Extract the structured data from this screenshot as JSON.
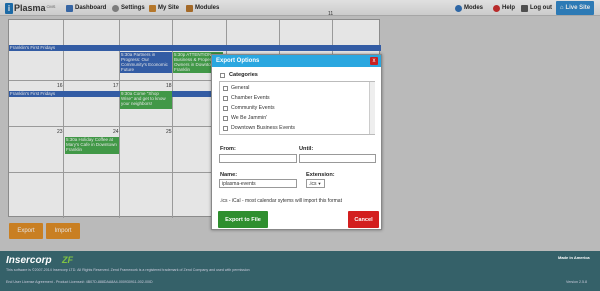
{
  "app": {
    "logo_text": "Plasma",
    "logo_sub": "CMS"
  },
  "nav": {
    "dashboard": "Dashboard",
    "settings": "Settings",
    "mysite": "My Site",
    "modules": "Modules",
    "modes": "Modes",
    "help": "Help",
    "logout": "Log out",
    "live": "Live Site"
  },
  "calendar": {
    "day_numbers": {
      "n11": "11",
      "n16": "16",
      "n17": "17",
      "n18": "18",
      "n23": "23",
      "n24": "24",
      "n25": "25"
    },
    "events": {
      "e1": "Franklin's First Fridays",
      "e2": "5:30a Partners in Progress: Our Community's Economic Future",
      "e3": "5:30p ATTENTION Business & Property Owners in Downtown Franklin",
      "e4": "Franklin's First Fridays",
      "e5": "9:30a Come \"Shop Wise\" and get to know your neighbors!",
      "e6": "5:30a Holiday Coffee at Mary's Cafe in Downtown Franklin"
    }
  },
  "buttons": {
    "export": "Export",
    "import": "Import"
  },
  "modal": {
    "title": "Export Options",
    "close": "x",
    "categories_label": "Categories",
    "categories": [
      "General",
      "Chamber Events",
      "Community Events",
      "We Be Jammin'",
      "Downtown Business Events"
    ],
    "from_label": "From:",
    "until_label": "Until:",
    "from_value": "",
    "until_value": "",
    "name_label": "Name:",
    "name_value": "iplasma-events",
    "extension_label": "Extension:",
    "extension_value": ".ics",
    "hint": ".ics - iCal - most calendar sytems will import this format",
    "export_button": "Export to File",
    "cancel_button": "Cancel"
  },
  "footer": {
    "logo": "Insercorp",
    "zf": "ZF",
    "copyright": "This software is ©2007-2014 Insercorp LTD. All Rights Reserved. Zend Framework is a registered trademark of Zend Company and used with permission",
    "license": "End User License Agreement - Product License#: 4B07D-888DAA8A4-000930911-002-00ID",
    "made_in": "Made in America",
    "version": "Version 2.5.8"
  },
  "colors": {
    "accent": "#2aa7e0",
    "export_btn": "#2f8f2f",
    "cancel_btn": "#d31f1f",
    "event_blue": "#3564b6",
    "event_green": "#45a84c",
    "footer": "#356169"
  }
}
